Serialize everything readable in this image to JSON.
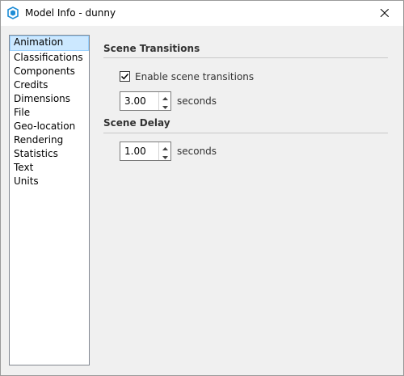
{
  "window": {
    "title": "Model Info - dunny"
  },
  "sidebar": {
    "items": [
      {
        "label": "Animation",
        "selected": true
      },
      {
        "label": "Classifications"
      },
      {
        "label": "Components"
      },
      {
        "label": "Credits"
      },
      {
        "label": "Dimensions"
      },
      {
        "label": "File"
      },
      {
        "label": "Geo-location"
      },
      {
        "label": "Rendering"
      },
      {
        "label": "Statistics"
      },
      {
        "label": "Text"
      },
      {
        "label": "Units"
      }
    ]
  },
  "scene_transitions": {
    "title": "Scene Transitions",
    "enable_label": "Enable scene transitions",
    "enable_checked": true,
    "duration_value": "3.00",
    "duration_unit": "seconds"
  },
  "scene_delay": {
    "title": "Scene Delay",
    "delay_value": "1.00",
    "delay_unit": "seconds"
  },
  "icons": {
    "app": "sketchup-logo-icon",
    "close": "close-icon",
    "check": "checkmark-icon",
    "spin_up": "spin-up-icon",
    "spin_down": "spin-down-icon"
  },
  "colors": {
    "selection_bg": "#cce8ff",
    "selection_border": "#99d1ff",
    "app_icon": "#1f8dd6"
  }
}
